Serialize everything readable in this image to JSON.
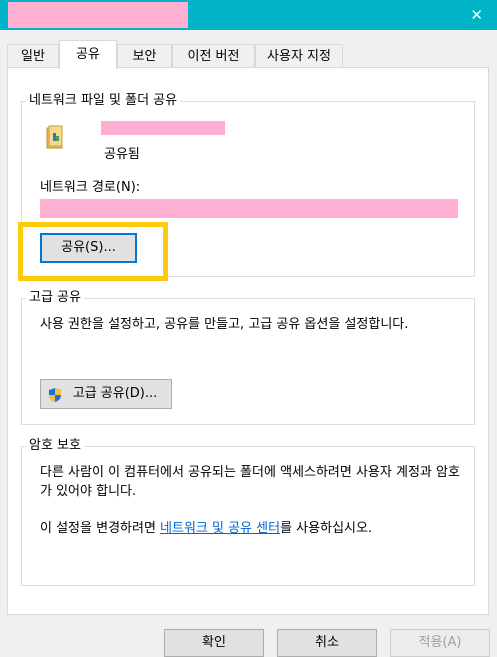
{
  "window": {
    "close_glyph": "✕"
  },
  "tabs": [
    {
      "label": "일반"
    },
    {
      "label": "공유"
    },
    {
      "label": "보안"
    },
    {
      "label": "이전 버전"
    },
    {
      "label": "사용자 지정"
    }
  ],
  "network_share": {
    "legend": "네트워크 파일 및 폴더 공유",
    "folder_status": "공유됨",
    "path_label": "네트워크 경로(N):",
    "share_button": "공유(S)..."
  },
  "advanced_share": {
    "legend": "고급 공유",
    "description": "사용 권한을 설정하고, 공유를 만들고, 고급 공유 옵션을 설정합니다.",
    "button": "고급 공유(D)..."
  },
  "password": {
    "legend": "암호 보호",
    "description": "다른 사람이 이 컴퓨터에서 공유되는 폴더에 액세스하려면 사용자 계정과 암호가 있어야 합니다.",
    "change_prefix": "이 설정을 변경하려면 ",
    "link": "네트워크 및 공유 센터",
    "change_suffix": "를 사용하십시오."
  },
  "footer": {
    "ok": "확인",
    "cancel": "취소",
    "apply": "적용(A)"
  },
  "colors": {
    "titlebar": "#00b3c7",
    "redaction": "#ffafd1",
    "highlight": "#fbcb0e",
    "link": "#0066cc"
  }
}
